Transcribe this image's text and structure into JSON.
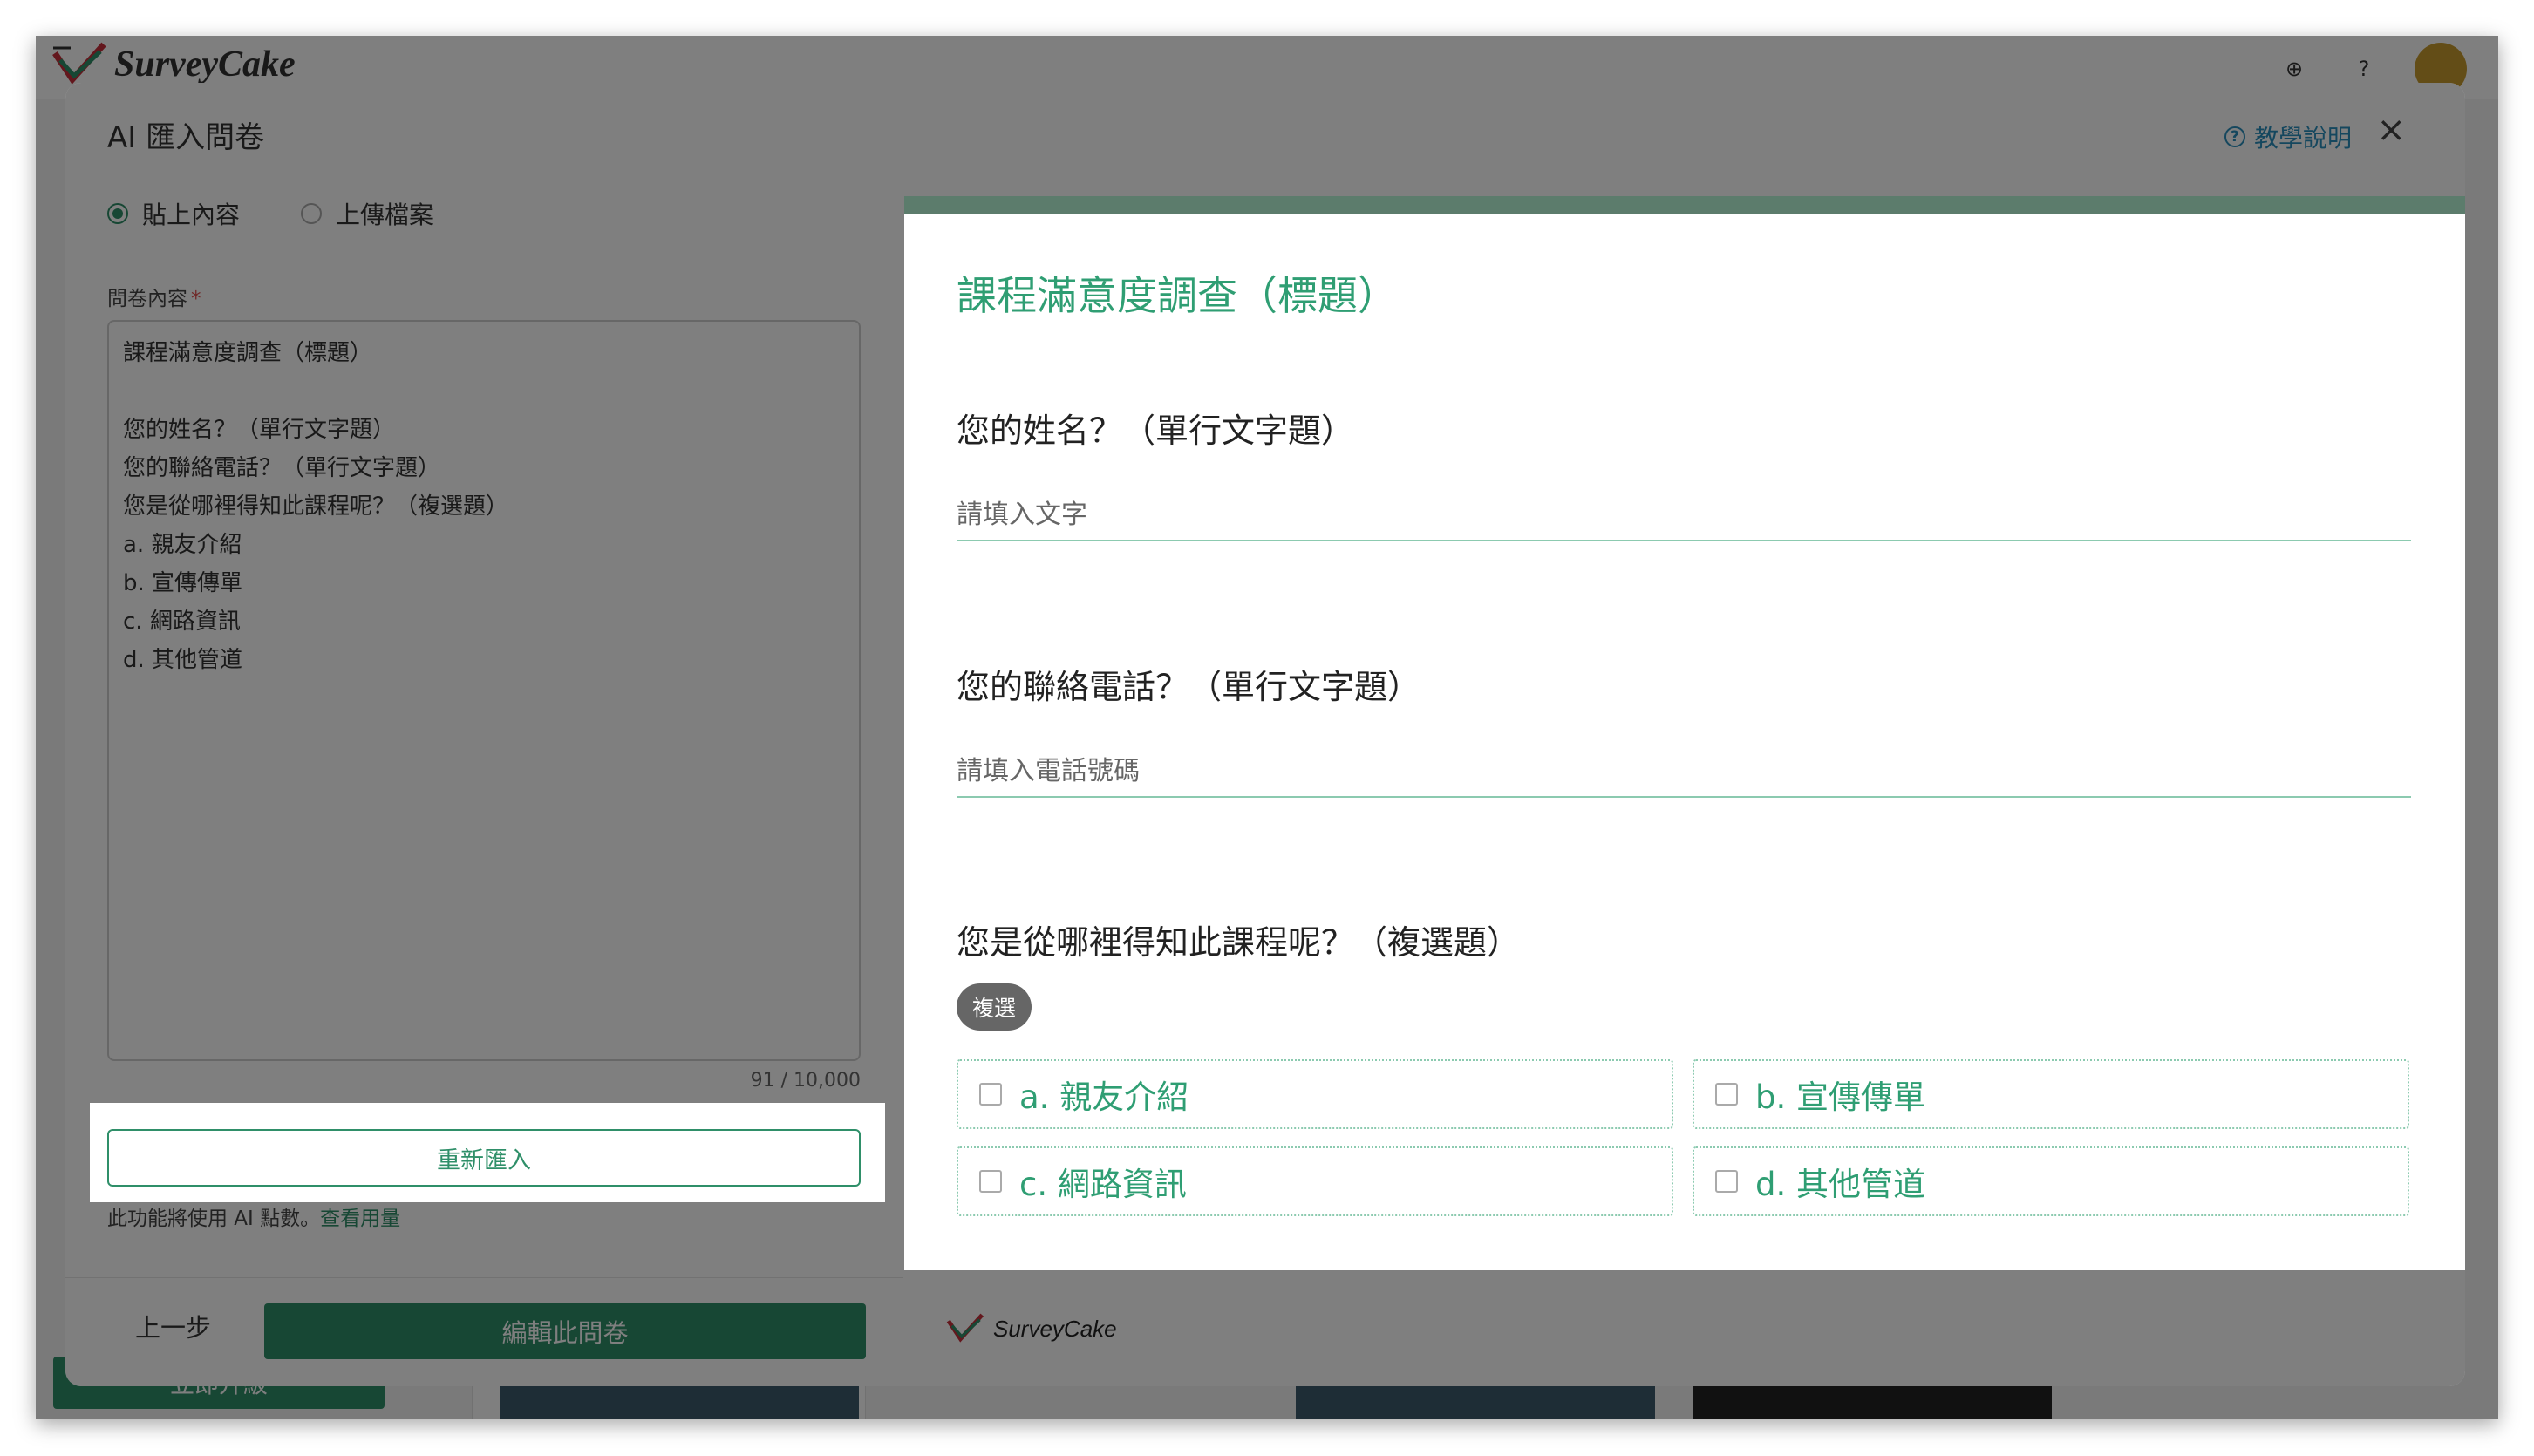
{
  "app": {
    "logo_text": "SurveyCake",
    "bg_button": "立即升級"
  },
  "modal": {
    "title": "AI 匯入問卷",
    "help_link": "教學說明",
    "close": "×"
  },
  "source": {
    "radio_paste": "貼上內容",
    "radio_upload": "上傳檔案",
    "field_label": "問卷內容",
    "required_mark": "*",
    "content_lines": [
      "課程滿意度調查（標題）",
      "",
      "您的姓名？（單行文字題）",
      "您的聯絡電話？（單行文字題）",
      "您是從哪裡得知此課程呢？（複選題）",
      "a. 親友介紹",
      "b. 宣傳傳單",
      "c. 網路資訊",
      "d. 其他管道"
    ],
    "char_count": "91 / 10,000",
    "reimport_button": "重新匯入",
    "ai_note": "此功能將使用 AI 點數。",
    "ai_note_link": "查看用量"
  },
  "footer": {
    "back_button": "上一步",
    "edit_button": "編輯此問卷",
    "preview_logo": "SurveyCake"
  },
  "preview": {
    "title": "課程滿意度調查（標題）",
    "q1": {
      "text": "您的姓名？（單行文字題）",
      "placeholder": "請填入文字"
    },
    "q2": {
      "text": "您的聯絡電話？（單行文字題）",
      "placeholder": "請填入電話號碼"
    },
    "q3": {
      "text": "您是從哪裡得知此課程呢？（複選題）",
      "badge": "複選",
      "options": [
        "a. 親友介紹",
        "b. 宣傳傳單",
        "c. 網路資訊",
        "d. 其他管道"
      ]
    }
  },
  "colors": {
    "brand_green": "#2f8f69",
    "preview_green": "#2f9e73",
    "link_blue": "#2a8fbd"
  }
}
